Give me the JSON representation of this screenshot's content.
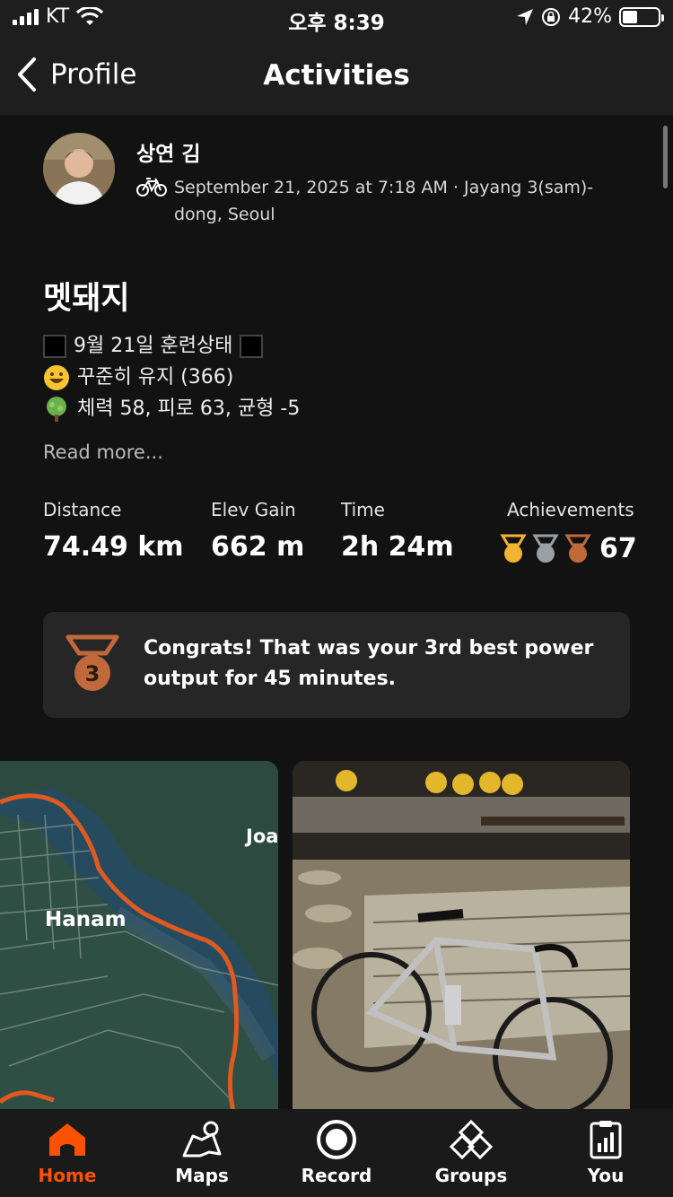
{
  "status_bar": {
    "carrier": "KT",
    "time": "오후 8:39",
    "battery_percent": "42%",
    "battery_level": 0.42
  },
  "nav": {
    "back_label": "Profile",
    "title": "Activities"
  },
  "athlete": {
    "name": "상연 김",
    "date_location": "September 21, 2025 at 7:18 AM · Jayang 3(sam)-dong, Seoul"
  },
  "activity": {
    "title": "멧돼지",
    "desc_line1": "9월 21일 훈련상태",
    "desc_line2": "꾸준히 유지 (366)",
    "desc_line3": "체력 58, 피로 63, 균형 -5",
    "read_more": "Read more..."
  },
  "stats": {
    "distance_label": "Distance",
    "distance_value": "74.49 km",
    "elev_label": "Elev Gain",
    "elev_value": "662 m",
    "time_label": "Time",
    "time_value": "2h 24m",
    "achievements_label": "Achievements",
    "achievements_value": "67"
  },
  "congrats": {
    "text": "Congrats! That was your 3rd best power output for 45 minutes.",
    "rank": "3"
  },
  "map": {
    "label_city": "Hanam",
    "label_partial": "Joa"
  },
  "tabs": [
    {
      "label": "Home",
      "icon": "home-icon",
      "active": true
    },
    {
      "label": "Maps",
      "icon": "maps-icon",
      "active": false
    },
    {
      "label": "Record",
      "icon": "record-icon",
      "active": false
    },
    {
      "label": "Groups",
      "icon": "groups-icon",
      "active": false
    },
    {
      "label": "You",
      "icon": "you-icon",
      "active": false
    }
  ],
  "colors": {
    "accent": "#fc5200",
    "gold": "#f1b42f",
    "silver": "#9aa0a4",
    "bronze": "#c06a3c",
    "background": "#121212",
    "card": "#262626"
  }
}
